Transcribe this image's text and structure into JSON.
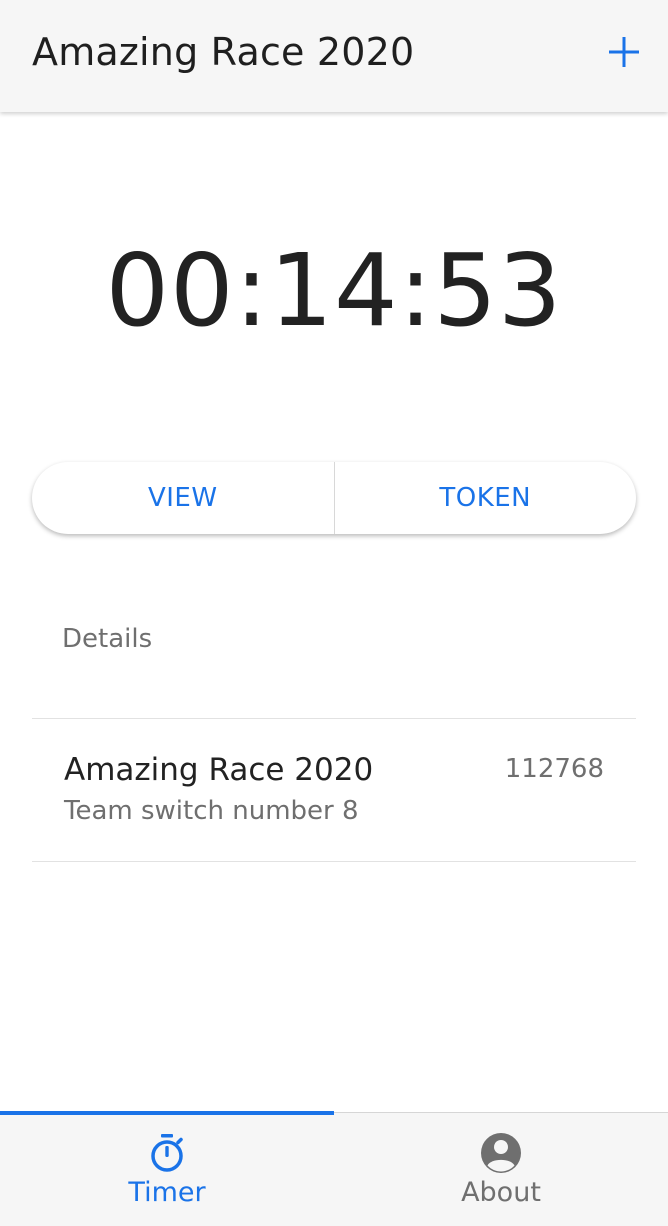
{
  "app_bar": {
    "title": "Amazing Race 2020",
    "add_icon": "plus-icon"
  },
  "timer": {
    "display": "00:14:53"
  },
  "segmented": {
    "view_label": "VIEW",
    "token_label": "TOKEN"
  },
  "details": {
    "section_label": "Details",
    "item": {
      "title": "Amazing Race 2020",
      "subtitle": "Team switch number 8",
      "number": "112768"
    }
  },
  "bottom_nav": {
    "active_tab": "Timer",
    "tabs": [
      {
        "label": "Timer",
        "icon": "stopwatch-icon"
      },
      {
        "label": "About",
        "icon": "account-circle-icon"
      }
    ]
  },
  "colors": {
    "accent": "#1a73e8",
    "secondary_text": "#6f6f6f",
    "bar_background": "#f6f6f6"
  }
}
